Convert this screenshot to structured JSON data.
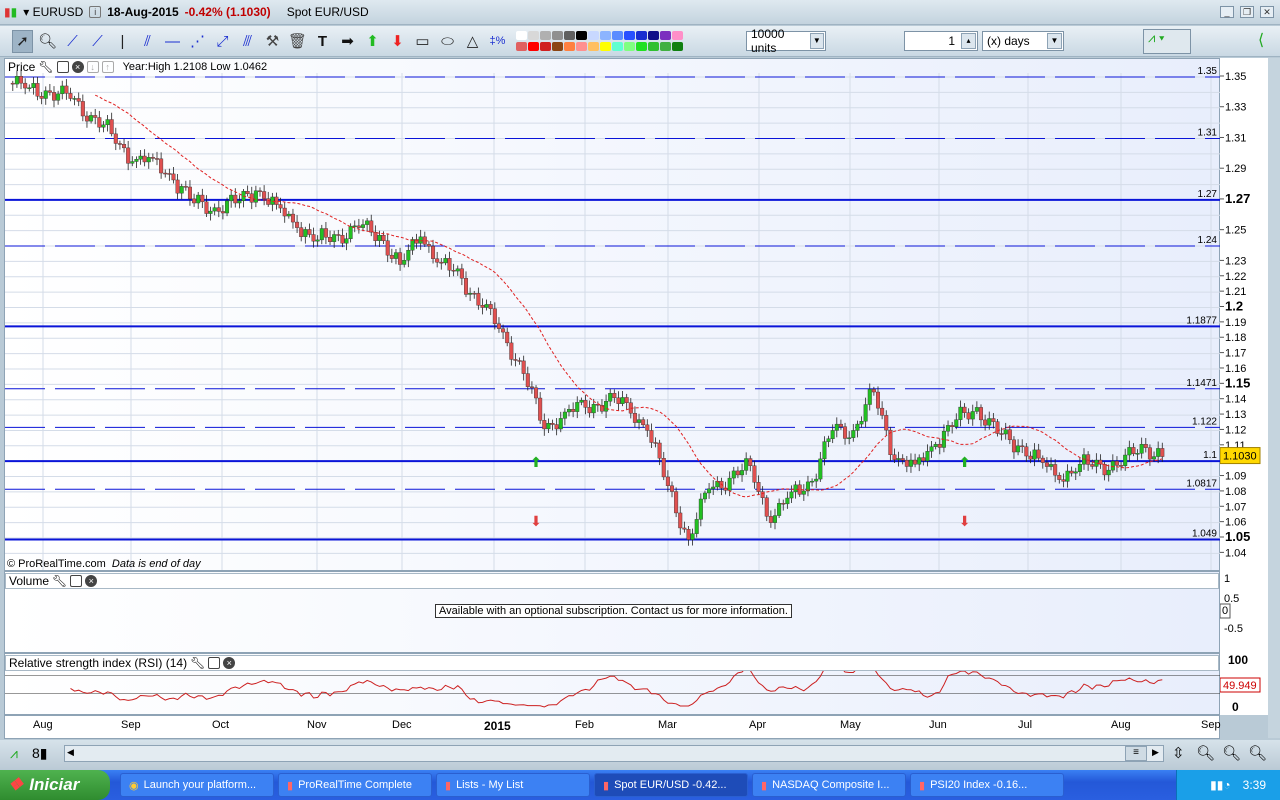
{
  "titlebar": {
    "symbol": "EURUSD",
    "date": "18-Aug-2015",
    "change": "-0.42% (1.1030)",
    "name": "Spot EUR/USD"
  },
  "toolbar": {
    "units": "10000 units",
    "period_value": "1",
    "period_unit": "(x) days",
    "tools": [
      "pointer",
      "zoom",
      "line-segment",
      "ray",
      "vertical-line",
      "channel",
      "horizontal-line",
      "fibonacci-fan",
      "trend-marker",
      "parallel-lines",
      "settings-tools",
      "delete",
      "text",
      "arrow-right",
      "arrow-up",
      "arrow-down",
      "rectangle",
      "ellipse",
      "triangle",
      "percent-retracement"
    ],
    "palette": [
      "#ffffff",
      "#d8d8d8",
      "#b0b0b0",
      "#909090",
      "#606060",
      "#000000",
      "#c8d8ff",
      "#8cb4ff",
      "#5a8cff",
      "#2850ff",
      "#1a2ed0",
      "#10108a",
      "#7b2fbf",
      "#ff8fc8",
      "#e06060",
      "#ff0000",
      "#d02020",
      "#8b4513",
      "#ff8040",
      "#ff9090",
      "#ffc060",
      "#ffff00",
      "#60ffd0",
      "#80ff80",
      "#20e020",
      "#30c030",
      "#40b040",
      "#108010"
    ]
  },
  "price_panel": {
    "label": "Price",
    "year_info": "Year:High 1.2108 Low 1.0462",
    "copyright": "© ProRealTime.com",
    "note": "Data is end of day",
    "current_price": "1.1030"
  },
  "volume_panel": {
    "label": "Volume",
    "message": "Available with an optional subscription. Contact us for more information.",
    "axis": [
      "1",
      "0.5",
      "0",
      "-0.5"
    ]
  },
  "rsi_panel": {
    "label": "Relative strength index (RSI) (14)",
    "axis": [
      "100",
      "0"
    ],
    "current": "49.949"
  },
  "x_labels": [
    "Aug",
    "Sep",
    "Oct",
    "Nov",
    "Dec",
    "2015",
    "Feb",
    "Mar",
    "Apr",
    "May",
    "Jun",
    "Jul",
    "Aug",
    "Sep"
  ],
  "y_labels": [
    {
      "v": 1.35,
      "t": "1.35",
      "bold": false
    },
    {
      "v": 1.33,
      "t": "1.33"
    },
    {
      "v": 1.31,
      "t": "1.31"
    },
    {
      "v": 1.29,
      "t": "1.29"
    },
    {
      "v": 1.27,
      "t": "1.27",
      "bold": true
    },
    {
      "v": 1.25,
      "t": "1.25"
    },
    {
      "v": 1.23,
      "t": "1.23"
    },
    {
      "v": 1.22,
      "t": "1.22"
    },
    {
      "v": 1.21,
      "t": "1.21"
    },
    {
      "v": 1.2,
      "t": "1.2",
      "bold": true
    },
    {
      "v": 1.19,
      "t": "1.19"
    },
    {
      "v": 1.18,
      "t": "1.18"
    },
    {
      "v": 1.17,
      "t": "1.17"
    },
    {
      "v": 1.16,
      "t": "1.16"
    },
    {
      "v": 1.15,
      "t": "1.15",
      "bold": true
    },
    {
      "v": 1.14,
      "t": "1.14"
    },
    {
      "v": 1.13,
      "t": "1.13"
    },
    {
      "v": 1.12,
      "t": "1.12"
    },
    {
      "v": 1.11,
      "t": "1.11"
    },
    {
      "v": 1.09,
      "t": "1.09"
    },
    {
      "v": 1.08,
      "t": "1.08"
    },
    {
      "v": 1.07,
      "t": "1.07"
    },
    {
      "v": 1.06,
      "t": "1.06"
    },
    {
      "v": 1.05,
      "t": "1.05",
      "bold": true
    },
    {
      "v": 1.04,
      "t": "1.04"
    }
  ],
  "chart_data": {
    "type": "candlestick",
    "title": "EURUSD Spot EUR/USD daily",
    "ylim": [
      1.035,
      1.36
    ],
    "weekly_closes": [
      1.343,
      1.34,
      1.336,
      1.325,
      1.313,
      1.295,
      1.297,
      1.283,
      1.268,
      1.265,
      1.268,
      1.276,
      1.267,
      1.252,
      1.244,
      1.247,
      1.252,
      1.247,
      1.228,
      1.246,
      1.229,
      1.219,
      1.2,
      1.184,
      1.157,
      1.121,
      1.132,
      1.135,
      1.139,
      1.138,
      1.12,
      1.084,
      1.049,
      1.082,
      1.089,
      1.097,
      1.06,
      1.08,
      1.087,
      1.12,
      1.12,
      1.145,
      1.101,
      1.098,
      1.111,
      1.127,
      1.135,
      1.118,
      1.11,
      1.102,
      1.088,
      1.098,
      1.098,
      1.097,
      1.111,
      1.103
    ],
    "horizontal_lines": [
      {
        "value": 1.35,
        "label": "1.35",
        "style": "dashed"
      },
      {
        "value": 1.31,
        "label": "1.31",
        "style": "dashed"
      },
      {
        "value": 1.27,
        "label": "1.27",
        "style": "solid"
      },
      {
        "value": 1.24,
        "label": "1.24",
        "style": "dashed"
      },
      {
        "value": 1.1877,
        "label": "1.1877",
        "style": "solid"
      },
      {
        "value": 1.1471,
        "label": "1.1471",
        "style": "dashed"
      },
      {
        "value": 1.122,
        "label": "1.122",
        "style": "dashed"
      },
      {
        "value": 1.1,
        "label": "1.1",
        "style": "solid"
      },
      {
        "value": 1.0817,
        "label": "1.0817",
        "style": "dashed"
      },
      {
        "value": 1.049,
        "label": "1.049",
        "style": "solid"
      }
    ],
    "signals": [
      {
        "week": 25,
        "dir": "up"
      },
      {
        "week": 25,
        "dir": "down"
      },
      {
        "week": 46,
        "dir": "up"
      },
      {
        "week": 46,
        "dir": "down"
      }
    ]
  },
  "scroll": {
    "thumb": "≡"
  },
  "taskbar": {
    "start": "Iniciar",
    "tasks": [
      "Launch your platform...",
      "ProRealTime Complete",
      "Lists - My List",
      "Spot EUR/USD  -0.42...",
      "NASDAQ Composite I...",
      "PSI20 Index  -0.16..."
    ],
    "clock": "3:39"
  }
}
